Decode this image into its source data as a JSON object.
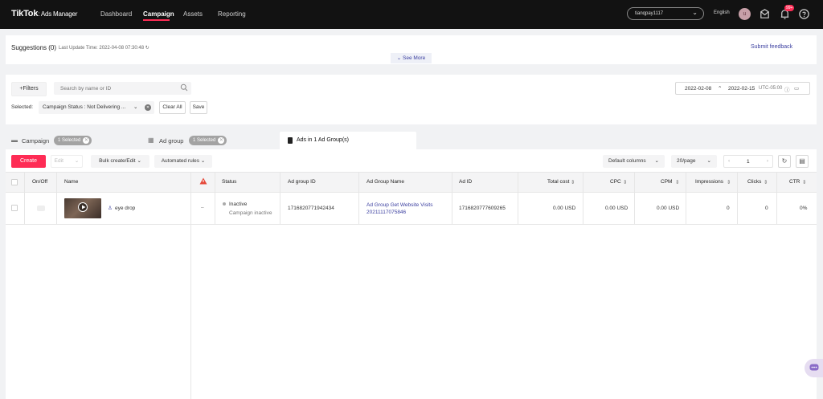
{
  "header": {
    "logo_main": "TikTok",
    "logo_sub": ": Ads Manager",
    "nav": [
      {
        "label": "Dashboard"
      },
      {
        "label": "Campaign"
      },
      {
        "label": "Assets"
      },
      {
        "label": "Reporting"
      }
    ],
    "account": "tianqpay1117",
    "language": "English",
    "avatar_initial": "u",
    "notification_count": "99+"
  },
  "suggestions": {
    "title": "Suggestions (0)",
    "last_update": "Last Update Time: 2022-04-08 07:30:48",
    "see_more": "See More",
    "feedback": "Submit feedback"
  },
  "filters": {
    "filters_label": "Filters",
    "search_placeholder": "Search by name or ID",
    "date_start": "2022-02-08",
    "date_end": "2022-02-15",
    "timezone": "UTC-05:00",
    "selected_label": "Selected:",
    "chip_text": "Campaign Status : Not Delivering ...",
    "clear_all": "Clear All",
    "save": "Save"
  },
  "levels": {
    "campaign": "Campaign",
    "campaign_badge": "1 Selected",
    "adgroup": "Ad group",
    "adgroup_badge": "1 Selected",
    "ads": "Ads in 1 Ad Group(s)"
  },
  "toolbar": {
    "create": "Create",
    "edit": "Edit",
    "bulk": "Bulk create/Edit",
    "automated": "Automated rules",
    "default_columns": "Default columns",
    "per_page": "20/page",
    "page": "1"
  },
  "table": {
    "columns": [
      "On/Off",
      "Name",
      "Status",
      "Ad group ID",
      "Ad Group Name",
      "Ad ID",
      "Total cost",
      "CPC",
      "CPM",
      "Impressions",
      "Clicks",
      "CTR"
    ],
    "row": {
      "name": "eye drop",
      "status": "Inactive",
      "status_detail": "Campaign inactive",
      "adgroup_id": "1716820771942434",
      "adgroup_name_1": "Ad Group Get Website Visits",
      "adgroup_name_2": "20211117075846",
      "ad_id": "1716820777609265",
      "total_cost": "0.00 USD",
      "cpc": "0.00 USD",
      "cpm": "0.00 USD",
      "impressions": "0",
      "clicks": "0",
      "ctr": "0%"
    }
  },
  "colors": {
    "brand_red": "#fe2c55",
    "link_purple": "#3b3fa0",
    "warning": "#e5483a"
  }
}
